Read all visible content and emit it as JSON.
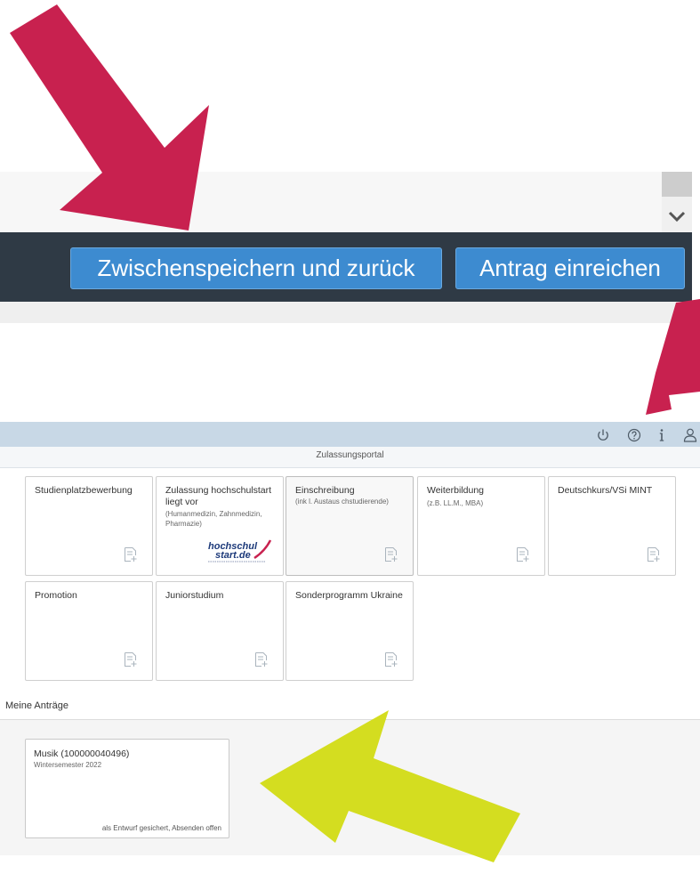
{
  "toolbar": {
    "save_back_label": "Zwischenspeichern und zurück",
    "submit_label": "Antrag einreichen"
  },
  "header": {
    "icons": [
      "power-icon",
      "help-icon",
      "info-icon",
      "user-icon"
    ]
  },
  "portal": {
    "title": "Zulassungsportal"
  },
  "tiles": [
    {
      "title": "Studienplatzbewerbung",
      "subtitle": ""
    },
    {
      "title": "Zulassung hochschulstart liegt vor",
      "subtitle": "(Humanmedizin, Zahnmedizin, Pharmazie)"
    },
    {
      "title": "Einschreibung",
      "subtitle": "(ink l. Austaus chstudierende)"
    },
    {
      "title": "Weiterbildung",
      "subtitle": "(z.B. LL.M., MBA)"
    },
    {
      "title": "Deutschkurs/VSi MINT",
      "subtitle": ""
    },
    {
      "title": "Promotion",
      "subtitle": ""
    },
    {
      "title": "Juniorstudium",
      "subtitle": ""
    },
    {
      "title": "Sonderprogramm Ukraine",
      "subtitle": ""
    }
  ],
  "logo": {
    "line1": "hochschul",
    "line2": "start.de"
  },
  "my_applications": {
    "heading": "Meine Anträge",
    "items": [
      {
        "title": "Musik (100000040496)",
        "term": "Wintersemester 2022",
        "status": "als Entwurf gesichert, Absenden offen"
      }
    ]
  },
  "colors": {
    "toolbar_bg": "#2f3a45",
    "button_bg": "#3d8bd0",
    "shell_header": "#c8d8e6",
    "arrow_red": "#c8214f",
    "arrow_yellow": "#d4dd20"
  }
}
